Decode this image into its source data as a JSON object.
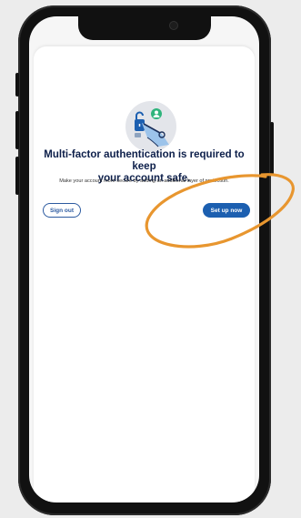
{
  "mfa_prompt": {
    "title_line1": "Multi-factor authentication is required to keep",
    "title_line2": "your account safe.",
    "subtitle": "Make your account more secure by adding an additional layer of protection.",
    "sign_out_label": "Sign out",
    "set_up_label": "Set up now",
    "illustration_icon": "mfa-lock-key-illustration"
  },
  "colors": {
    "primary": "#1c5fb0",
    "title": "#0d1f4a",
    "annotation": "#e8962f"
  }
}
